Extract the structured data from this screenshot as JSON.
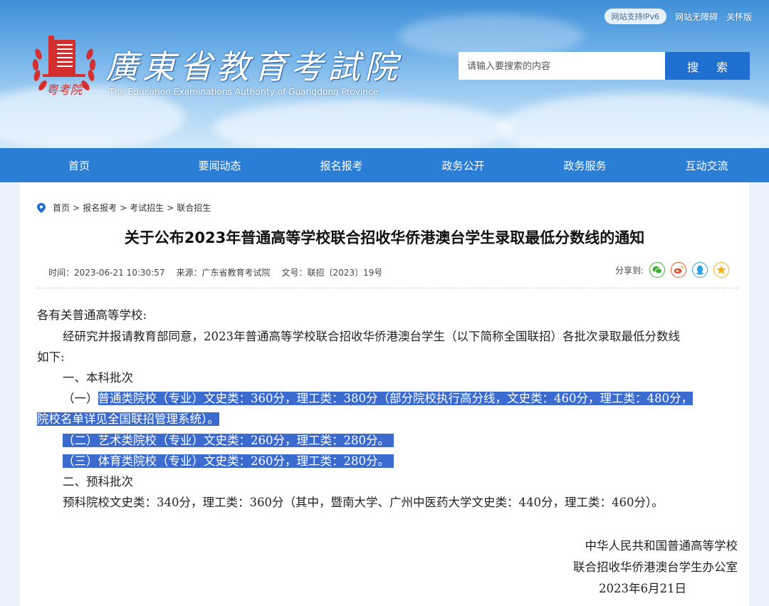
{
  "header": {
    "ipv6_badge": "网站支持IPv6",
    "accessibility_link": "网站无障碍",
    "care_link": "关怀版",
    "logo_title": "廣東省教育考試院",
    "logo_subtitle": "The Education Examinations Authority of Guangdong Province",
    "logo_seal_text": "粤考院",
    "search": {
      "placeholder": "请输入要搜索的内容",
      "button_label": "搜 索"
    }
  },
  "nav": {
    "items": [
      {
        "label": "首页"
      },
      {
        "label": "要闻动态"
      },
      {
        "label": "报名报考"
      },
      {
        "label": "政务公开"
      },
      {
        "label": "政务服务"
      },
      {
        "label": "互动交流"
      }
    ]
  },
  "breadcrumb": {
    "items": [
      "首页",
      "报名报考",
      "考试招生",
      "联合招生"
    ],
    "separator": ">"
  },
  "article": {
    "title": "关于公布2023年普通高等学校联合招收华侨港澳台学生录取最低分数线的通知",
    "meta": {
      "time": "时间：2023-06-21 10:30:57",
      "source": "来源：广东省教育考试院",
      "doc_no": "文号：联招〔2023〕19号"
    },
    "share_label": "分享到:",
    "body": {
      "salutation": "各有关普通高等学校:",
      "intro_1": "经研究并报请教育部同意，2023年普通高等学校联合招收华侨港澳台学生（以下简称全国联招）各批次录取最低分数线",
      "intro_2": "如下:",
      "sec1_title": "一、本科批次",
      "sec1_item1_prefix": "（一）",
      "sec1_item1_a": "普通类院校（专业）文史类：360分，理工类：380分（部分院校执行高分线，文史类：460分，理工类：480分，",
      "sec1_item1_b": "院校名单详见全国联招管理系统）。",
      "sec1_item2": "（二）艺术类院校（专业）文史类：260分，理工类：280分。",
      "sec1_item3": "（三）体育类院校（专业）文史类：260分，理工类：280分。",
      "sec2_title": "二、预科批次",
      "sec2_item": "预科院校文史类：340分，理工类：360分（其中，暨南大学、广州中医药大学文史类：440分，理工类：460分）。"
    },
    "signature": {
      "line1": "中华人民共和国普通高等学校",
      "line2": "联合招收华侨港澳台学生办公室",
      "date": "2023年6月21日"
    }
  },
  "colors": {
    "nav_bg": "#2b7ed5",
    "search_btn": "#1f6fd1",
    "highlight": "#3c6bd0",
    "seal_red": "#d32f2f"
  },
  "icons": [
    "location-pin-icon",
    "wechat-icon",
    "weibo-icon",
    "qq-icon",
    "qzone-icon",
    "search-icon"
  ]
}
